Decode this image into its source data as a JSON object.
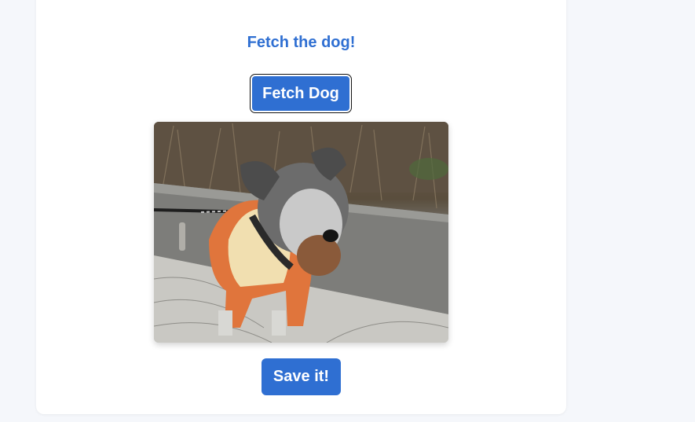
{
  "heading": "Fetch the dog!",
  "fetch_button_label": "Fetch Dog",
  "save_button_label": "Save it!",
  "colors": {
    "accent": "#2f6fd2",
    "page_background": "#f5f7fb",
    "card_background": "#ffffff"
  },
  "dog_image": {
    "description_icon": "schnauzer-dog-photo"
  }
}
